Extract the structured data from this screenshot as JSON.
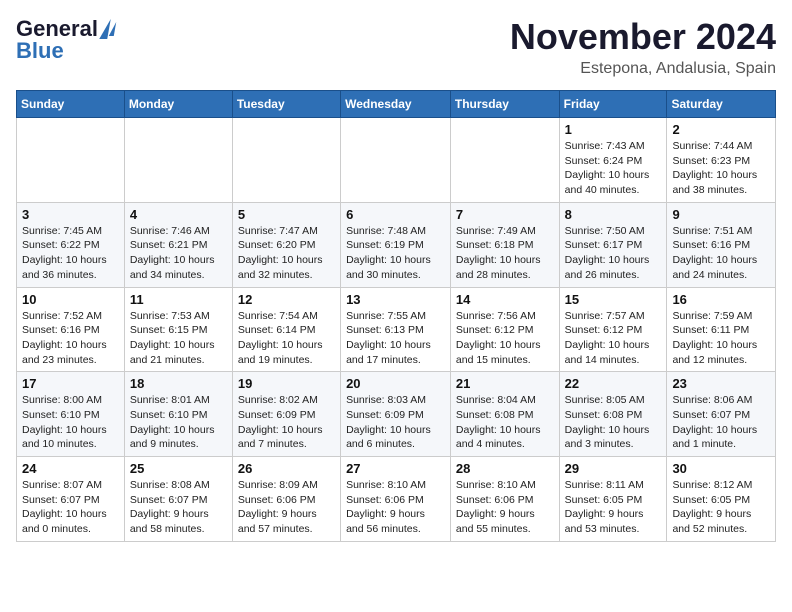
{
  "header": {
    "logo_line1": "General",
    "logo_line2": "Blue",
    "month": "November 2024",
    "location": "Estepona, Andalusia, Spain"
  },
  "weekdays": [
    "Sunday",
    "Monday",
    "Tuesday",
    "Wednesday",
    "Thursday",
    "Friday",
    "Saturday"
  ],
  "weeks": [
    [
      {
        "day": "",
        "info": ""
      },
      {
        "day": "",
        "info": ""
      },
      {
        "day": "",
        "info": ""
      },
      {
        "day": "",
        "info": ""
      },
      {
        "day": "",
        "info": ""
      },
      {
        "day": "1",
        "info": "Sunrise: 7:43 AM\nSunset: 6:24 PM\nDaylight: 10 hours and 40 minutes."
      },
      {
        "day": "2",
        "info": "Sunrise: 7:44 AM\nSunset: 6:23 PM\nDaylight: 10 hours and 38 minutes."
      }
    ],
    [
      {
        "day": "3",
        "info": "Sunrise: 7:45 AM\nSunset: 6:22 PM\nDaylight: 10 hours and 36 minutes."
      },
      {
        "day": "4",
        "info": "Sunrise: 7:46 AM\nSunset: 6:21 PM\nDaylight: 10 hours and 34 minutes."
      },
      {
        "day": "5",
        "info": "Sunrise: 7:47 AM\nSunset: 6:20 PM\nDaylight: 10 hours and 32 minutes."
      },
      {
        "day": "6",
        "info": "Sunrise: 7:48 AM\nSunset: 6:19 PM\nDaylight: 10 hours and 30 minutes."
      },
      {
        "day": "7",
        "info": "Sunrise: 7:49 AM\nSunset: 6:18 PM\nDaylight: 10 hours and 28 minutes."
      },
      {
        "day": "8",
        "info": "Sunrise: 7:50 AM\nSunset: 6:17 PM\nDaylight: 10 hours and 26 minutes."
      },
      {
        "day": "9",
        "info": "Sunrise: 7:51 AM\nSunset: 6:16 PM\nDaylight: 10 hours and 24 minutes."
      }
    ],
    [
      {
        "day": "10",
        "info": "Sunrise: 7:52 AM\nSunset: 6:16 PM\nDaylight: 10 hours and 23 minutes."
      },
      {
        "day": "11",
        "info": "Sunrise: 7:53 AM\nSunset: 6:15 PM\nDaylight: 10 hours and 21 minutes."
      },
      {
        "day": "12",
        "info": "Sunrise: 7:54 AM\nSunset: 6:14 PM\nDaylight: 10 hours and 19 minutes."
      },
      {
        "day": "13",
        "info": "Sunrise: 7:55 AM\nSunset: 6:13 PM\nDaylight: 10 hours and 17 minutes."
      },
      {
        "day": "14",
        "info": "Sunrise: 7:56 AM\nSunset: 6:12 PM\nDaylight: 10 hours and 15 minutes."
      },
      {
        "day": "15",
        "info": "Sunrise: 7:57 AM\nSunset: 6:12 PM\nDaylight: 10 hours and 14 minutes."
      },
      {
        "day": "16",
        "info": "Sunrise: 7:59 AM\nSunset: 6:11 PM\nDaylight: 10 hours and 12 minutes."
      }
    ],
    [
      {
        "day": "17",
        "info": "Sunrise: 8:00 AM\nSunset: 6:10 PM\nDaylight: 10 hours and 10 minutes."
      },
      {
        "day": "18",
        "info": "Sunrise: 8:01 AM\nSunset: 6:10 PM\nDaylight: 10 hours and 9 minutes."
      },
      {
        "day": "19",
        "info": "Sunrise: 8:02 AM\nSunset: 6:09 PM\nDaylight: 10 hours and 7 minutes."
      },
      {
        "day": "20",
        "info": "Sunrise: 8:03 AM\nSunset: 6:09 PM\nDaylight: 10 hours and 6 minutes."
      },
      {
        "day": "21",
        "info": "Sunrise: 8:04 AM\nSunset: 6:08 PM\nDaylight: 10 hours and 4 minutes."
      },
      {
        "day": "22",
        "info": "Sunrise: 8:05 AM\nSunset: 6:08 PM\nDaylight: 10 hours and 3 minutes."
      },
      {
        "day": "23",
        "info": "Sunrise: 8:06 AM\nSunset: 6:07 PM\nDaylight: 10 hours and 1 minute."
      }
    ],
    [
      {
        "day": "24",
        "info": "Sunrise: 8:07 AM\nSunset: 6:07 PM\nDaylight: 10 hours and 0 minutes."
      },
      {
        "day": "25",
        "info": "Sunrise: 8:08 AM\nSunset: 6:07 PM\nDaylight: 9 hours and 58 minutes."
      },
      {
        "day": "26",
        "info": "Sunrise: 8:09 AM\nSunset: 6:06 PM\nDaylight: 9 hours and 57 minutes."
      },
      {
        "day": "27",
        "info": "Sunrise: 8:10 AM\nSunset: 6:06 PM\nDaylight: 9 hours and 56 minutes."
      },
      {
        "day": "28",
        "info": "Sunrise: 8:10 AM\nSunset: 6:06 PM\nDaylight: 9 hours and 55 minutes."
      },
      {
        "day": "29",
        "info": "Sunrise: 8:11 AM\nSunset: 6:05 PM\nDaylight: 9 hours and 53 minutes."
      },
      {
        "day": "30",
        "info": "Sunrise: 8:12 AM\nSunset: 6:05 PM\nDaylight: 9 hours and 52 minutes."
      }
    ]
  ]
}
